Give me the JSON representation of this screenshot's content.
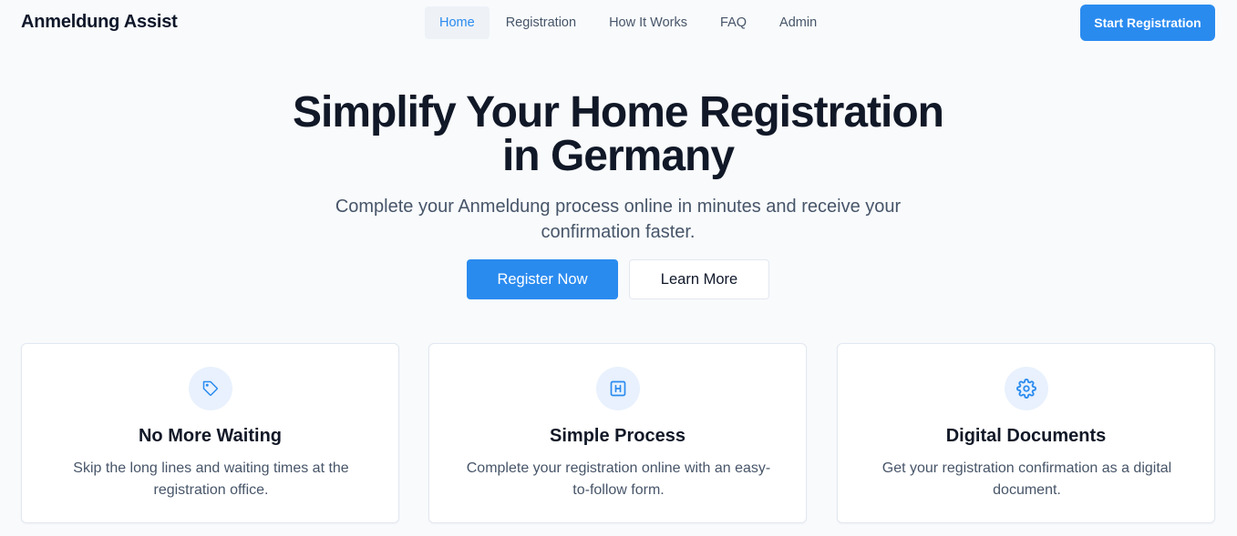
{
  "header": {
    "brand": "Anmeldung Assist",
    "nav": [
      {
        "label": "Home",
        "active": true
      },
      {
        "label": "Registration",
        "active": false
      },
      {
        "label": "How It Works",
        "active": false
      },
      {
        "label": "FAQ",
        "active": false
      },
      {
        "label": "Admin",
        "active": false
      }
    ],
    "cta_label": "Start Registration"
  },
  "hero": {
    "title_line1": "Simplify Your Home Registration",
    "title_line2": "in Germany",
    "subtitle_line1": "Complete your Anmeldung process online in minutes and receive your",
    "subtitle_line2": "confirmation faster.",
    "primary_button": "Register Now",
    "secondary_button": "Learn More"
  },
  "features": [
    {
      "icon": "tag-icon",
      "title": "No More Waiting",
      "text_line1": "Skip the long lines and waiting times at the",
      "text_line2": "registration office."
    },
    {
      "icon": "form-icon",
      "title": "Simple Process",
      "text_line1": "Complete your registration online with an easy-",
      "text_line2": "to-follow form."
    },
    {
      "icon": "gear-icon",
      "title": "Digital Documents",
      "text_line1": "Get your registration confirmation as a digital",
      "text_line2": "document."
    }
  ],
  "colors": {
    "accent": "#2a8bef",
    "background": "#f8fafc",
    "text_dark": "#111827",
    "text_muted": "#475569",
    "icon_bg": "#e8f1fd"
  }
}
